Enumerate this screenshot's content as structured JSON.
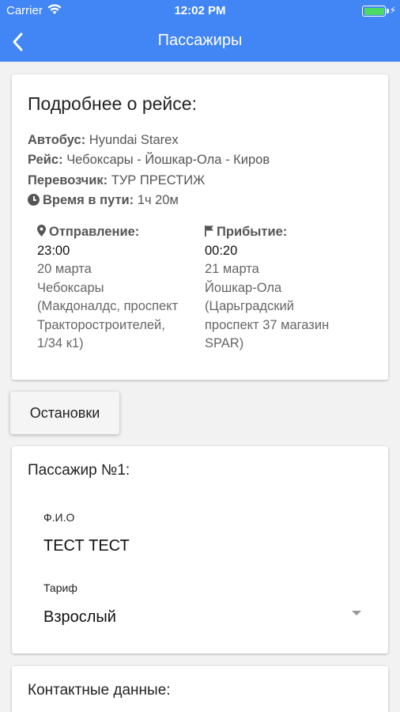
{
  "status_bar": {
    "carrier": "Carrier",
    "time": "12:02 PM"
  },
  "nav": {
    "title": "Пассажиры"
  },
  "trip": {
    "heading": "Подробнее о рейсе:",
    "bus_label": "Автобус:",
    "bus_value": "Hyundai Starex",
    "route_label": "Рейс:",
    "route_value": "Чебоксары - Йошкар-Ола - Киров",
    "carrier_label": "Перевозчик:",
    "carrier_value": "ТУР ПРЕСТИЖ",
    "duration_label": "Время в пути:",
    "duration_value": "1ч 20м",
    "departure": {
      "label": "Отправление:",
      "time": "23:00",
      "date": "20 марта",
      "place_lines": [
        "Чебоксары",
        "(Макдоналдс, проспект",
        "Тракторостроителей,",
        "1/34 к1)"
      ]
    },
    "arrival": {
      "label": "Прибытие:",
      "time": "00:20",
      "date": "21 марта",
      "place_lines": [
        "Йошкар-Ола",
        "(Царьградский",
        "проспект 37 магазин",
        "SPAR)"
      ]
    }
  },
  "stops_button": {
    "label": "Остановки"
  },
  "passenger": {
    "heading": "Пассажир №1:",
    "name_label": "Ф.И.О",
    "name_value": "ТЕСТ ТЕСТ",
    "tariff_label": "Тариф",
    "tariff_value": "Взрослый"
  },
  "contact": {
    "heading": "Контактные данные:"
  },
  "colors": {
    "accent": "#4285f4",
    "battery": "#4cd964"
  }
}
